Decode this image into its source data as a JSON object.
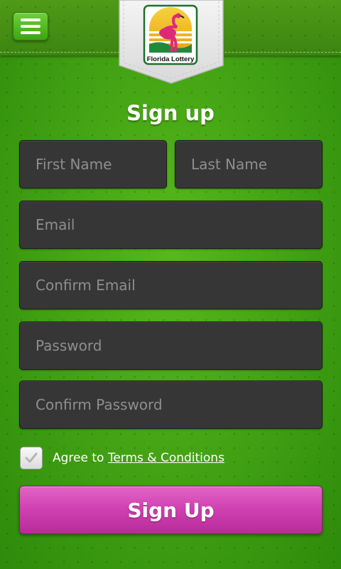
{
  "header": {
    "menu_icon": "hamburger-menu-icon",
    "logo_text": "Florida Lottery"
  },
  "title": "Sign up",
  "form": {
    "first_name_placeholder": "First Name",
    "last_name_placeholder": "Last Name",
    "email_placeholder": "Email",
    "confirm_email_placeholder": "Confirm Email",
    "password_placeholder": "Password",
    "confirm_password_placeholder": "Confirm Password",
    "agree_prefix": "Agree to ",
    "terms_link": "Terms & Conditions",
    "terms_checked": false,
    "submit_label": "Sign Up"
  },
  "colors": {
    "background_green": "#44a414",
    "field_dark": "#363636",
    "button_magenta": "#cf3fb0"
  }
}
